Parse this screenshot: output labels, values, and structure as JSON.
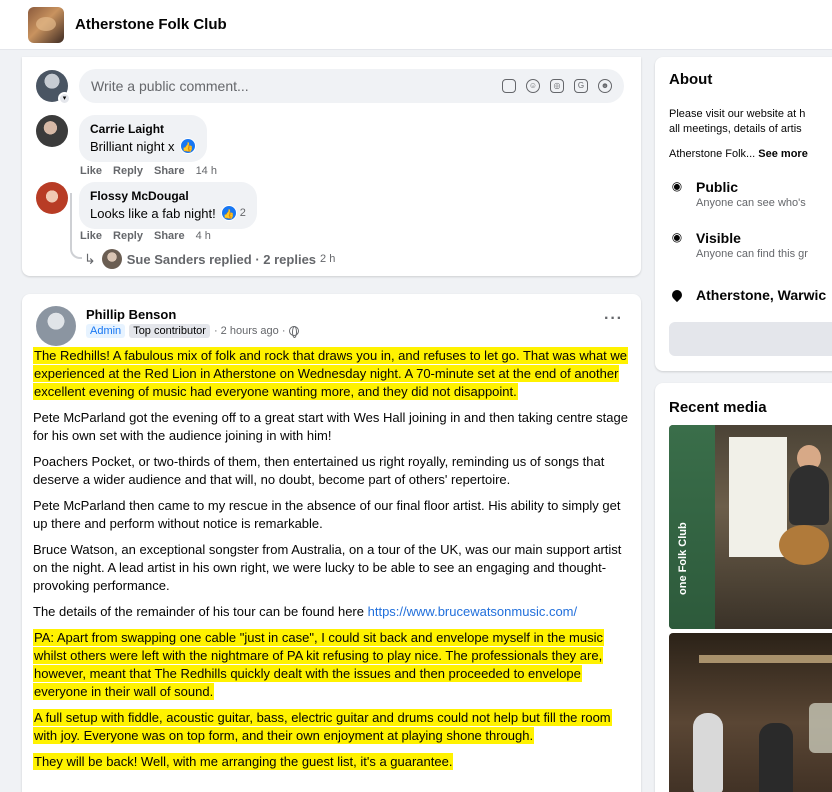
{
  "header": {
    "group_name": "Atherstone Folk Club"
  },
  "comments_card": {
    "composer_placeholder": "Write a public comment...",
    "composer_icons": [
      "sticker-icon",
      "emoji-icon",
      "camera-icon",
      "gif-icon",
      "avatar-sticker-icon"
    ],
    "comments": [
      {
        "author": "Carrie Laight",
        "text": "Brilliant night x",
        "actions": {
          "like": "Like",
          "reply": "Reply",
          "share": "Share",
          "time": "14 h"
        }
      },
      {
        "author": "Flossy McDougal",
        "text": "Looks like a fab night!",
        "reaction_count": "2",
        "actions": {
          "like": "Like",
          "reply": "Reply",
          "share": "Share",
          "time": "4 h"
        }
      }
    ],
    "replies": {
      "author": "Sue Sanders",
      "text": "Sue Sanders replied · 2 replies",
      "time": "2 h"
    }
  },
  "post": {
    "author": "Phillip Benson",
    "badge_admin": "Admin",
    "badge_top": "Top contributor",
    "time": "· 2 hours ago ·",
    "paragraphs": [
      "The Redhills!  A fabulous mix of folk and rock that draws you in, and refuses to let go.  That was what we experienced at the Red Lion in Atherstone on Wednesday night.  A 70-minute set at the end of another excellent evening of music had everyone wanting more, and they did not disappoint.",
      "Pete McParland got the evening off to a great start with Wes Hall joining in and then taking centre stage for his own set with the audience joining in with him!",
      "Poachers Pocket, or two-thirds of them, then entertained us right royally, reminding us of songs that deserve a wider audience and that will, no doubt, become part of others' repertoire.",
      "Pete McParland then came to my rescue in the absence of our final floor artist.  His ability to simply get up there and perform without notice is remarkable.",
      "Bruce Watson, an exceptional songster from Australia, on a tour of the UK, was our main support artist on the night.  A lead artist in his own right, we were lucky to be able to see an engaging and thought-provoking performance.",
      "The details of the remainder of his tour can be found here",
      "PA:  Apart from swapping one cable \"just in case\", I could sit back and envelope myself in the music whilst others were left with the nightmare of PA kit refusing to play nice.  The professionals they are, however, meant that The Redhills quickly dealt with the issues and then proceeded to envelope everyone in their wall of sound.",
      "A full setup with fiddle, acoustic guitar, bass, electric guitar and drums could not help but fill the room with joy.  Everyone was on top form, and their own enjoyment at playing shone through.",
      "They will be back!  Well, with me arranging the guest list, it's a guarantee."
    ],
    "tour_link": "https://www.brucewatsonmusic.com/",
    "highlight_color": "#fff200"
  },
  "about": {
    "title": "About",
    "desc_line1": "Please visit our website at h",
    "desc_line2": "all meetings, details of artis",
    "short": "Atherstone Folk...",
    "see_more": "See more",
    "items": [
      {
        "title": "Public",
        "sub": "Anyone can see who's",
        "icon": "globe-icon"
      },
      {
        "title": "Visible",
        "sub": "Anyone can find this gr",
        "icon": "eye-icon"
      },
      {
        "title": "Atherstone, Warwic",
        "icon": "location-pin-icon"
      }
    ]
  },
  "media": {
    "title": "Recent media",
    "banner_text": "one Folk Club"
  },
  "colors": {
    "accent": "#1877f2",
    "link": "#216fdb",
    "secondary_text": "#65676b",
    "page_bg": "#f0f2f5"
  }
}
